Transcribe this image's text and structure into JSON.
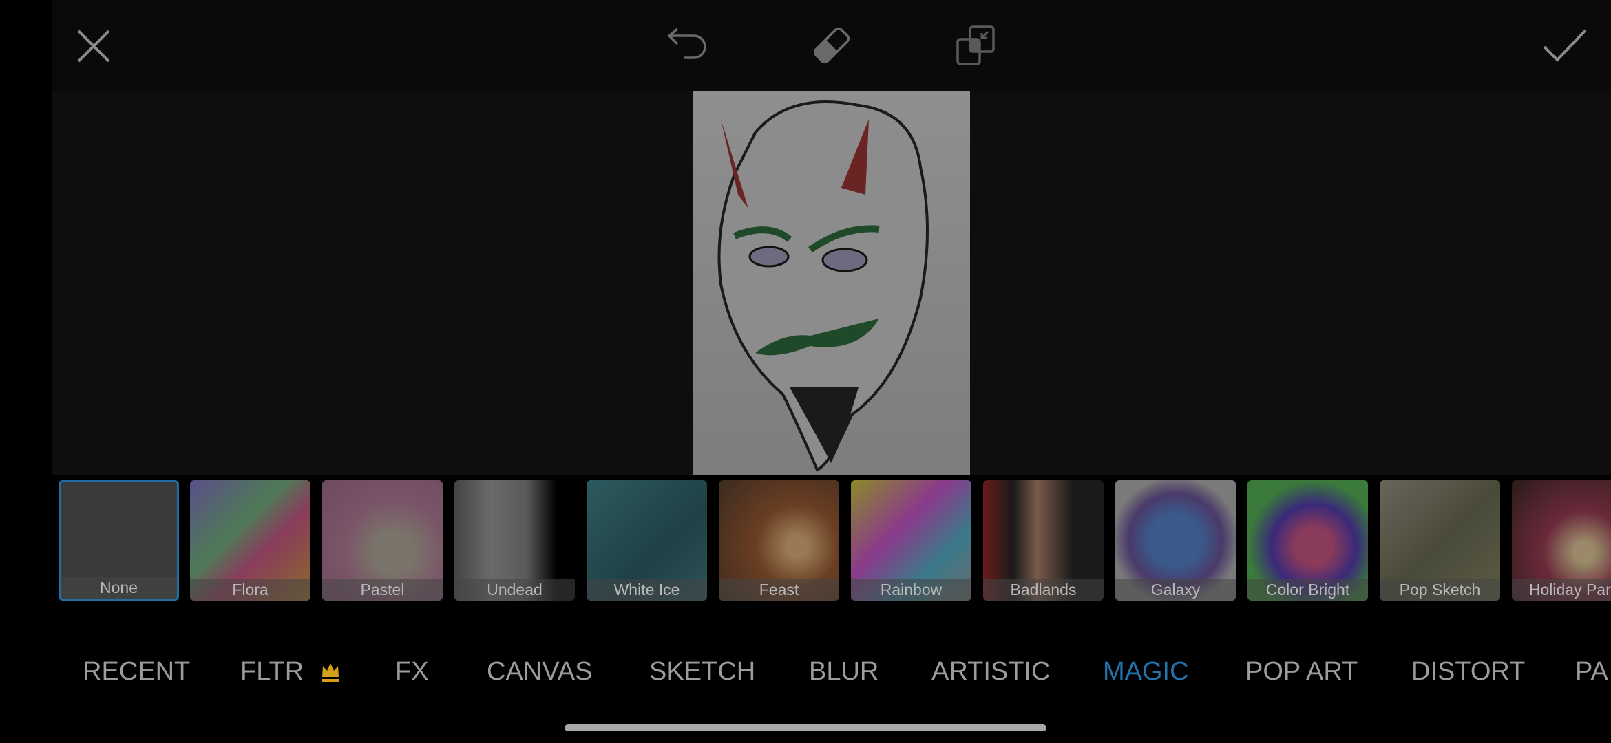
{
  "toolbar": {
    "icons": [
      "close-icon",
      "undo-icon",
      "eraser-icon",
      "compare-icon",
      "check-icon"
    ]
  },
  "filters": [
    {
      "label": "None",
      "selected": true
    },
    {
      "label": "Flora"
    },
    {
      "label": "Pastel"
    },
    {
      "label": "Undead"
    },
    {
      "label": "White Ice"
    },
    {
      "label": "Feast"
    },
    {
      "label": "Rainbow"
    },
    {
      "label": "Badlands"
    },
    {
      "label": "Galaxy"
    },
    {
      "label": "Color Bright"
    },
    {
      "label": "Pop Sketch"
    },
    {
      "label": "Holiday Part"
    }
  ],
  "categories": [
    {
      "label": "RECENT"
    },
    {
      "label": "FLTR",
      "premium": true
    },
    {
      "label": "FX"
    },
    {
      "label": "CANVAS"
    },
    {
      "label": "SKETCH"
    },
    {
      "label": "BLUR"
    },
    {
      "label": "ARTISTIC"
    },
    {
      "label": "MAGIC",
      "active": true
    },
    {
      "label": "POP ART"
    },
    {
      "label": "DISTORT"
    },
    {
      "label": "PA"
    }
  ],
  "colors": {
    "accent": "#2273ae",
    "premium": "#d4a017",
    "text": "#9c9c9c"
  }
}
